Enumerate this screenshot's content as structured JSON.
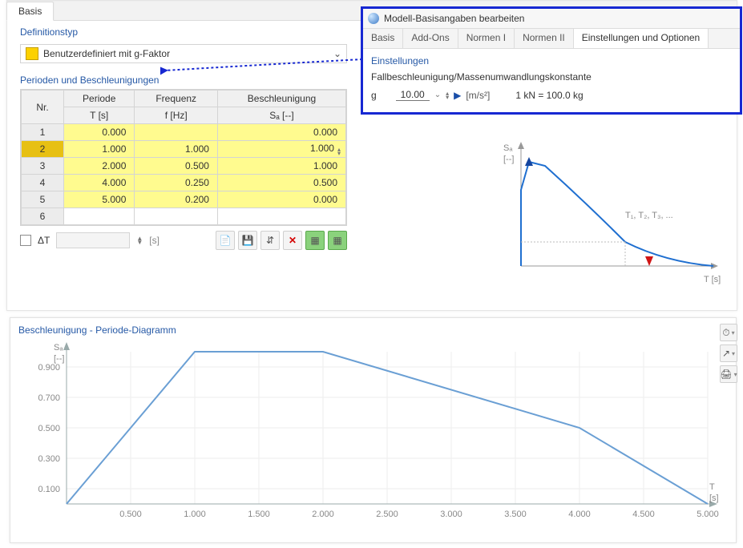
{
  "tab_main": "Basis",
  "definitionstyp_label": "Definitionstyp",
  "dd_text": "Benutzerdefiniert mit g-Faktor",
  "perioden_label": "Perioden und Beschleunigungen",
  "headers": {
    "nr": "Nr.",
    "periode": "Periode",
    "periode_unit": "T [s]",
    "frequenz": "Frequenz",
    "frequenz_unit": "f [Hz]",
    "beschl": "Beschleunigung",
    "beschl_unit": "Sₐ [--]"
  },
  "rows": [
    {
      "nr": "1",
      "T": "0.000",
      "f": "",
      "Sa": "0.000"
    },
    {
      "nr": "2",
      "T": "1.000",
      "f": "1.000",
      "Sa": "1.000"
    },
    {
      "nr": "3",
      "T": "2.000",
      "f": "0.500",
      "Sa": "1.000"
    },
    {
      "nr": "4",
      "T": "4.000",
      "f": "0.250",
      "Sa": "0.500"
    },
    {
      "nr": "5",
      "T": "5.000",
      "f": "0.200",
      "Sa": "0.000"
    },
    {
      "nr": "6",
      "T": "",
      "f": "",
      "Sa": ""
    }
  ],
  "dt_label": "ΔT",
  "dt_unit": "[s]",
  "modal": {
    "title": "Modell-Basisangaben bearbeiten",
    "tabs": [
      "Basis",
      "Add-Ons",
      "Normen I",
      "Normen II",
      "Einstellungen und Optionen"
    ],
    "active_tab": 4,
    "section": "Einstellungen",
    "desc": "Fallbeschleunigung/Massenumwandlungskonstante",
    "g_symbol": "g",
    "g_value": "10.00",
    "g_unit": "[m/s²]",
    "kn_text": "1 kN = 100.0 kg"
  },
  "chart_sm": {
    "ylabel": "Sₐ\n[--]",
    "xlabel": "T [s]",
    "annot": "T₁, T₂, T₃, ..."
  },
  "chart_main": {
    "title": "Beschleunigung - Periode-Diagramm",
    "ylabel1": "Sₐ",
    "ylabel2": "[--]",
    "xlabel1": "T",
    "xlabel2": "[s]",
    "yticks": [
      "0.100",
      "0.300",
      "0.500",
      "0.700",
      "0.900"
    ],
    "xticks": [
      "0.500",
      "1.000",
      "1.500",
      "2.000",
      "2.500",
      "3.000",
      "3.500",
      "4.000",
      "4.500",
      "5.000"
    ]
  },
  "chart_data": {
    "type": "line",
    "title": "Beschleunigung - Periode-Diagramm",
    "xlabel": "T [s]",
    "ylabel": "Sₐ [--]",
    "x": [
      0,
      1,
      2,
      4,
      5
    ],
    "y": [
      0,
      1,
      1,
      0.5,
      0
    ],
    "xlim": [
      0,
      5
    ],
    "ylim": [
      0,
      1
    ]
  }
}
